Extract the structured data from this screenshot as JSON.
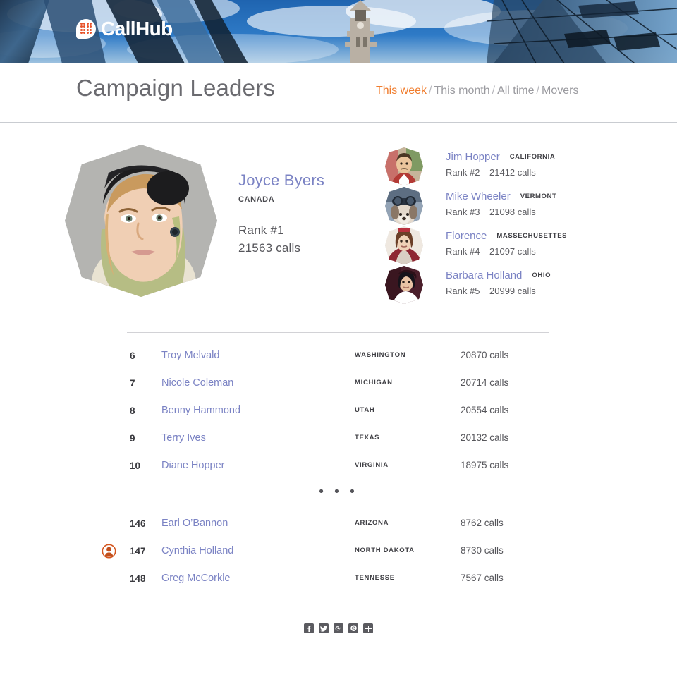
{
  "brand": {
    "name": "CallHub",
    "logo_icon": "speech-bubble-dots-icon",
    "accent_color": "#e8532b"
  },
  "header": {
    "title": "Campaign Leaders",
    "filters": [
      {
        "label": "This week",
        "active": true
      },
      {
        "label": "This month",
        "active": false
      },
      {
        "label": "All time",
        "active": false
      },
      {
        "label": "Movers",
        "active": false
      }
    ],
    "separator": "/"
  },
  "leader": {
    "name": "Joyce Byers",
    "region": "CANADA",
    "rank": "Rank #1",
    "calls": "21563 calls",
    "avatar": "joyce-byers-photo"
  },
  "runners_up": [
    {
      "name": "Jim Hopper",
      "region": "CALIFORNIA",
      "rank": "Rank #2",
      "calls": "21412 calls"
    },
    {
      "name": "Mike Wheeler",
      "region": "VERMONT",
      "rank": "Rank #3",
      "calls": "21098 calls"
    },
    {
      "name": "Florence",
      "region": "MASSECHUSETTES",
      "rank": "Rank #4",
      "calls": "21097 calls"
    },
    {
      "name": "Barbara Holland",
      "region": "OHIO",
      "rank": "Rank #5",
      "calls": "20999 calls"
    }
  ],
  "table": {
    "top_rows": [
      {
        "rank": "6",
        "name": "Troy Melvald",
        "region": "WASHINGTON",
        "calls": "20870 calls",
        "is_me": false
      },
      {
        "rank": "7",
        "name": "Nicole Coleman",
        "region": "MICHIGAN",
        "calls": "20714 calls",
        "is_me": false
      },
      {
        "rank": "8",
        "name": "Benny Hammond",
        "region": "UTAH",
        "calls": "20554 calls",
        "is_me": false
      },
      {
        "rank": "9",
        "name": "Terry Ives",
        "region": "TEXAS",
        "calls": "20132 calls",
        "is_me": false
      },
      {
        "rank": "10",
        "name": "Diane Hopper",
        "region": "VIRGINIA",
        "calls": "18975 calls",
        "is_me": false
      }
    ],
    "gap_marker": "• • •",
    "bottom_rows": [
      {
        "rank": "146",
        "name": "Earl O’Bannon",
        "region": "ARIZONA",
        "calls": "8762 calls",
        "is_me": false
      },
      {
        "rank": "147",
        "name": "Cynthia Holland",
        "region": "NORTH  DAKOTA",
        "calls": "8730 calls",
        "is_me": true
      },
      {
        "rank": "148",
        "name": "Greg McCorkle",
        "region": "TENNESSE",
        "calls": "7567 calls",
        "is_me": false
      }
    ]
  },
  "social": [
    {
      "icon": "facebook-icon",
      "glyph": "f"
    },
    {
      "icon": "twitter-icon",
      "glyph": ""
    },
    {
      "icon": "google-plus-icon",
      "glyph": "g"
    },
    {
      "icon": "pinterest-icon",
      "glyph": "p"
    },
    {
      "icon": "share-more-icon",
      "glyph": "+"
    }
  ],
  "colors": {
    "accent_orange": "#f07d2e",
    "name_link": "#7b83c4",
    "me_marker": "#d4561f"
  }
}
